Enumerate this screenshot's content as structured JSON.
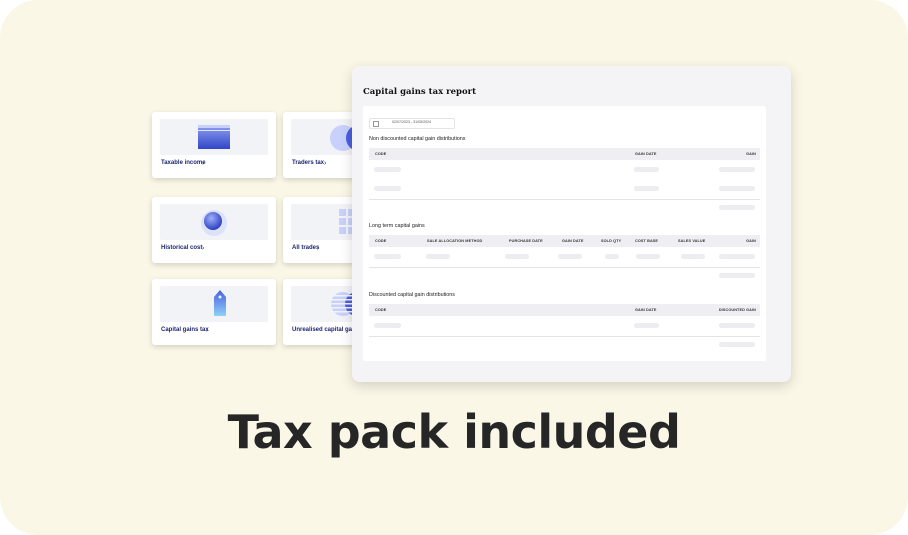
{
  "cards": {
    "taxable_income": "Taxable income",
    "traders_tax": "Traders tax",
    "historical_cost": "Historical cost",
    "all_trades": "All trades",
    "capital_gains_tax": "Capital gains tax",
    "unrealised_capital_gains": "Unrealised capital gains",
    "chevron": "›"
  },
  "report": {
    "title": "Capital gains tax report",
    "date_range": "02/07/2023 - 31/05/2024",
    "section1": {
      "title": "Non discounted capital gain distributions",
      "columns": [
        "CODE",
        "GAIN DATE",
        "GAIN"
      ]
    },
    "section2": {
      "title": "Long term capital gains",
      "columns": [
        "CODE",
        "SALE ALLOCATION METHOD",
        "PURCHASE DATE",
        "GAIN DATE",
        "SOLD QTY",
        "COST BASE",
        "SALES VALUE",
        "GAIN"
      ]
    },
    "section3": {
      "title": "Discounted capital gain distributions",
      "columns": [
        "CODE",
        "GAIN DATE",
        "DISCOUNTED GAIN"
      ]
    }
  },
  "headline": "Tax pack included",
  "colors": {
    "background": "#fbf7e7",
    "card_label": "#1c2670",
    "accent_blue": "#4a5fe0",
    "accent_light": "#c8d1fb"
  },
  "icons": {
    "taxable_income": "document-stack-icon",
    "traders_tax": "overlapping-circles-icon",
    "historical_cost": "ring-orb-icon",
    "all_trades": "tile-grid-icon",
    "capital_gains_tax": "price-tag-icon",
    "unrealised_capital_gains": "striped-circles-icon",
    "date_range": "calendar-icon"
  }
}
